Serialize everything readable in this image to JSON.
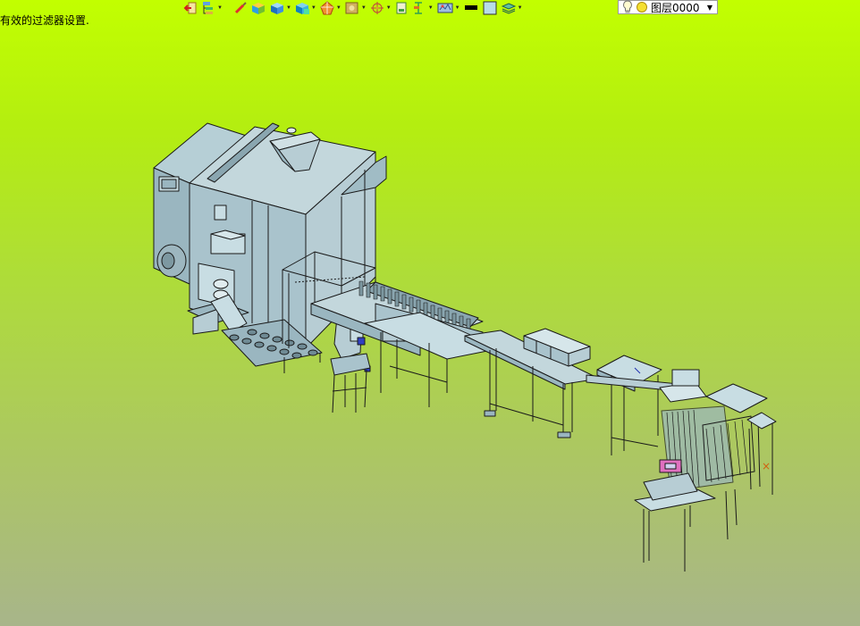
{
  "status_message": "有效的过滤器设置.",
  "toolbar": {
    "buttons": [
      {
        "id": "exit",
        "icon": "exit-door-icon"
      },
      {
        "id": "tree",
        "icon": "tree-structure-icon"
      },
      {
        "id": "paint",
        "icon": "paintbrush-icon"
      },
      {
        "id": "color",
        "icon": "color-cube-icon"
      },
      {
        "id": "blue-cube",
        "icon": "blue-cube-icon"
      },
      {
        "id": "render",
        "icon": "render-style-icon"
      },
      {
        "id": "explode",
        "icon": "explode-shape-icon"
      },
      {
        "id": "texture",
        "icon": "texture-icon"
      },
      {
        "id": "compass",
        "icon": "compass-icon"
      },
      {
        "id": "frame",
        "icon": "frame-icon"
      },
      {
        "id": "dimension",
        "icon": "dimension-icon"
      },
      {
        "id": "map",
        "icon": "layer-map-icon"
      },
      {
        "id": "linetype",
        "icon": "line-type-icon"
      },
      {
        "id": "fill",
        "icon": "fill-color-icon"
      },
      {
        "id": "layers",
        "icon": "layers-stack-icon"
      }
    ]
  },
  "layer_dropdown": {
    "value": "图层0000",
    "icons": [
      "light-bulb-icon",
      "layer-sun-icon"
    ]
  },
  "scene": {
    "description_colors": {
      "equipment_fill": "#a9c3cc",
      "equipment_dark": "#8aa6b0",
      "edge": "#1a1a1a"
    }
  }
}
